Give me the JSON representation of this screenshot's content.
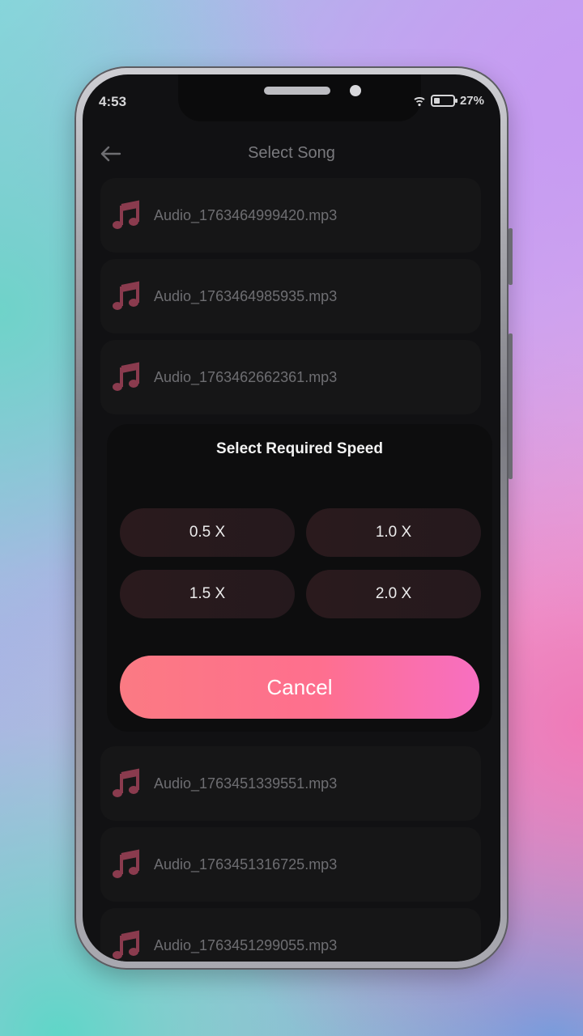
{
  "status_bar": {
    "time": "4:53",
    "battery": "27%"
  },
  "header": {
    "title": "Select Song"
  },
  "songs": [
    "Audio_1763464999420.mp3",
    "Audio_1763464985935.mp3",
    "Audio_1763462662361.mp3",
    "Audio_1763451339551.mp3",
    "Audio_1763451316725.mp3",
    "Audio_1763451299055.mp3"
  ],
  "dialog": {
    "title": "Select Required Speed",
    "speeds": [
      "0.5 X",
      "1.0 X",
      "1.5 X",
      "2.0 X"
    ],
    "cancel_label": "Cancel"
  },
  "colors": {
    "accent_start": "#fb7a83",
    "accent_end": "#f76fc1",
    "music_icon": "#8a3b4e"
  },
  "icons": {
    "back": "arrow-left-icon",
    "song": "music-note-icon"
  }
}
